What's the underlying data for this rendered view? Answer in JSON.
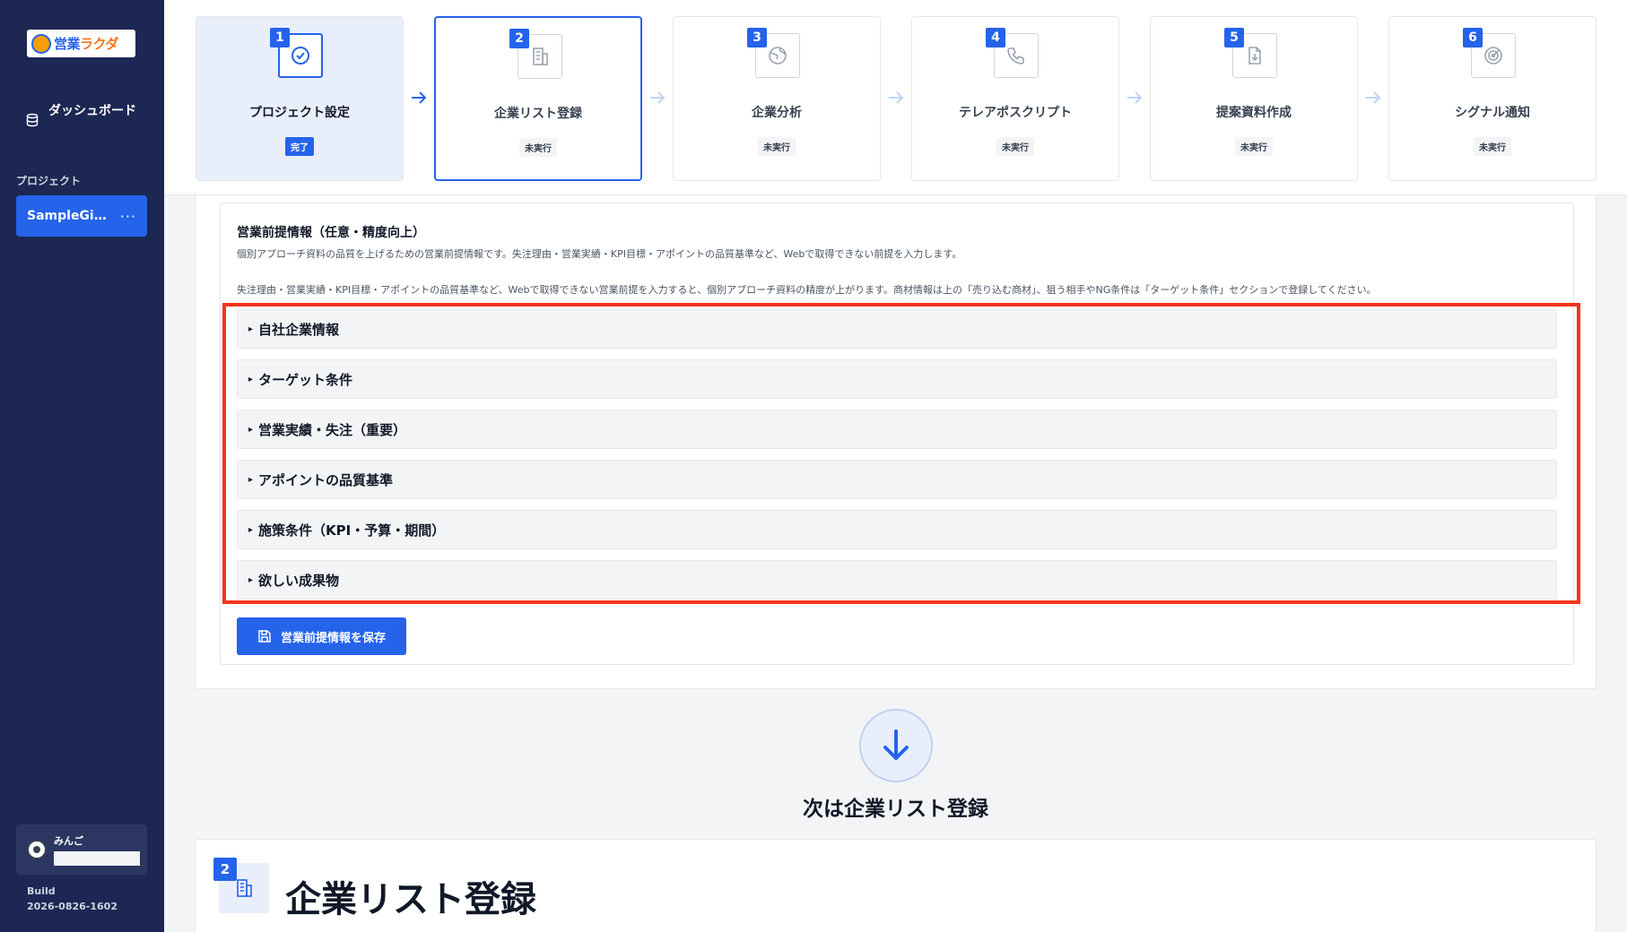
{
  "sidebar": {
    "logo_text_a": "営業",
    "logo_text_b": "ラクダ",
    "dashboard_label": "ダッシュボード",
    "projects_label": "プロジェクト",
    "project_name": "SampleGi…",
    "project_menu": "···",
    "user_name": "みんご",
    "build_label": "Build",
    "build_value": "2026-0826-1602"
  },
  "steps": [
    {
      "num": "1",
      "title": "プロジェクト設定",
      "status": "完了",
      "icon": "check-circle-icon"
    },
    {
      "num": "2",
      "title": "企業リスト登録",
      "status": "未実行",
      "icon": "building-icon"
    },
    {
      "num": "3",
      "title": "企業分析",
      "status": "未実行",
      "icon": "globe-icon"
    },
    {
      "num": "4",
      "title": "テレアポスクリプト",
      "status": "未実行",
      "icon": "phone-icon"
    },
    {
      "num": "5",
      "title": "提案資料作成",
      "status": "未実行",
      "icon": "file-download-icon"
    },
    {
      "num": "6",
      "title": "シグナル通知",
      "status": "未実行",
      "icon": "radar-icon"
    }
  ],
  "premise": {
    "title": "営業前提情報（任意・精度向上）",
    "desc1": "個別アプローチ資料の品質を上げるための営業前提情報です。失注理由・営業実績・KPI目標・アポイントの品質基準など、Webで取得できない前提を入力します。",
    "desc2": "失注理由・営業実績・KPI目標・アポイントの品質基準など、Webで取得できない営業前提を入力すると、個別アプローチ資料の精度が上がります。商材情報は上の「売り込む商材」、狙う相手やNG条件は「ターゲット条件」セクションで登録してください。",
    "accordions": [
      "自社企業情報",
      "ターゲット条件",
      "営業実績・失注（重要）",
      "アポイントの品質基準",
      "施策条件（KPI・予算・期間）",
      "欲しい成果物"
    ],
    "triangle": "▸",
    "save_label": "営業前提情報を保存"
  },
  "next": {
    "text": "次は企業リスト登録"
  },
  "section": {
    "num": "2",
    "title": "企業リスト登録"
  },
  "colors": {
    "accent": "#2563eb",
    "sidebar": "#1c2753",
    "highlight": "#f5341b"
  }
}
